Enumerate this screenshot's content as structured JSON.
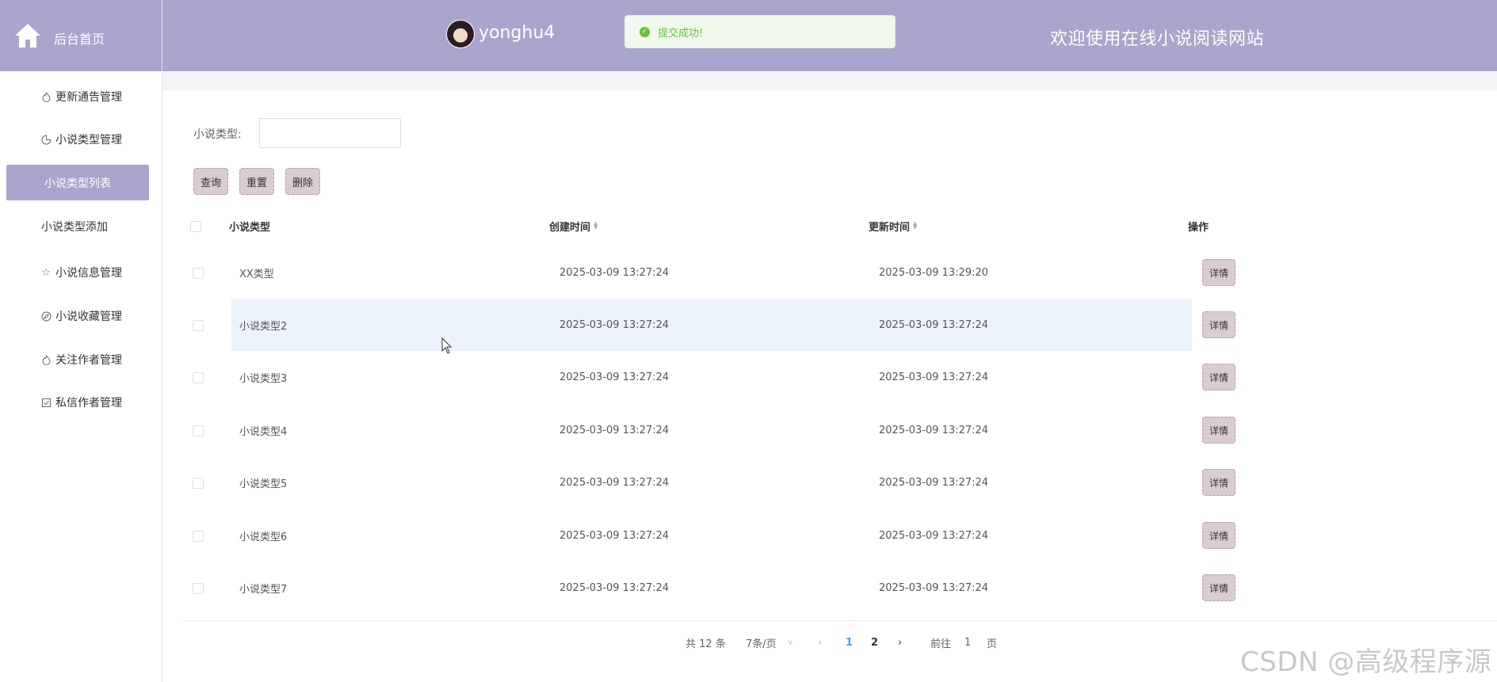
{
  "sidebar": {
    "logo_text": "后台首页",
    "items": [
      {
        "label": "更新通告管理",
        "icon": "flame-icon"
      },
      {
        "label": "小说类型管理",
        "icon": "pie-chart-icon"
      },
      {
        "label": "小说类型列表",
        "active": true
      },
      {
        "label": "小说类型添加"
      },
      {
        "label": "小说信息管理",
        "icon": "star-icon"
      },
      {
        "label": "小说收藏管理",
        "icon": "compass-icon"
      },
      {
        "label": "关注作者管理",
        "icon": "flame-icon"
      },
      {
        "label": "私信作者管理",
        "icon": "checkbox-icon"
      }
    ]
  },
  "header": {
    "username": "yonghu4",
    "welcome": "欢迎使用在线小说阅读网站",
    "toast": "提交成功!"
  },
  "search": {
    "label": "小说类型:",
    "value": "",
    "buttons": {
      "query": "查询",
      "reset": "重置",
      "delete": "删除"
    }
  },
  "table": {
    "columns": [
      "小说类型",
      "创建时间",
      "更新时间",
      "操作"
    ],
    "detail_label": "详情",
    "rows": [
      {
        "type": "XX类型",
        "created": "2025-03-09 13:27:24",
        "updated": "2025-03-09 13:29:20"
      },
      {
        "type": "小说类型2",
        "created": "2025-03-09 13:27:24",
        "updated": "2025-03-09 13:27:24",
        "highlighted": true
      },
      {
        "type": "小说类型3",
        "created": "2025-03-09 13:27:24",
        "updated": "2025-03-09 13:27:24"
      },
      {
        "type": "小说类型4",
        "created": "2025-03-09 13:27:24",
        "updated": "2025-03-09 13:27:24"
      },
      {
        "type": "小说类型5",
        "created": "2025-03-09 13:27:24",
        "updated": "2025-03-09 13:27:24"
      },
      {
        "type": "小说类型6",
        "created": "2025-03-09 13:27:24",
        "updated": "2025-03-09 13:27:24"
      },
      {
        "type": "小说类型7",
        "created": "2025-03-09 13:27:24",
        "updated": "2025-03-09 13:27:24"
      }
    ]
  },
  "pagination": {
    "total": "共 12 条",
    "page_size": "7条/页",
    "pages": [
      "1",
      "2"
    ],
    "current_page": "1",
    "goto_prefix": "前往",
    "goto_value": "1",
    "goto_suffix": "页"
  },
  "watermark": "CSDN @高级程序源",
  "colors": {
    "brand": "#a9a5cc",
    "button": "#d9ccd2",
    "highlight_row": "#ecf2fb",
    "success": "#67c23a",
    "page_active": "#409eff"
  }
}
